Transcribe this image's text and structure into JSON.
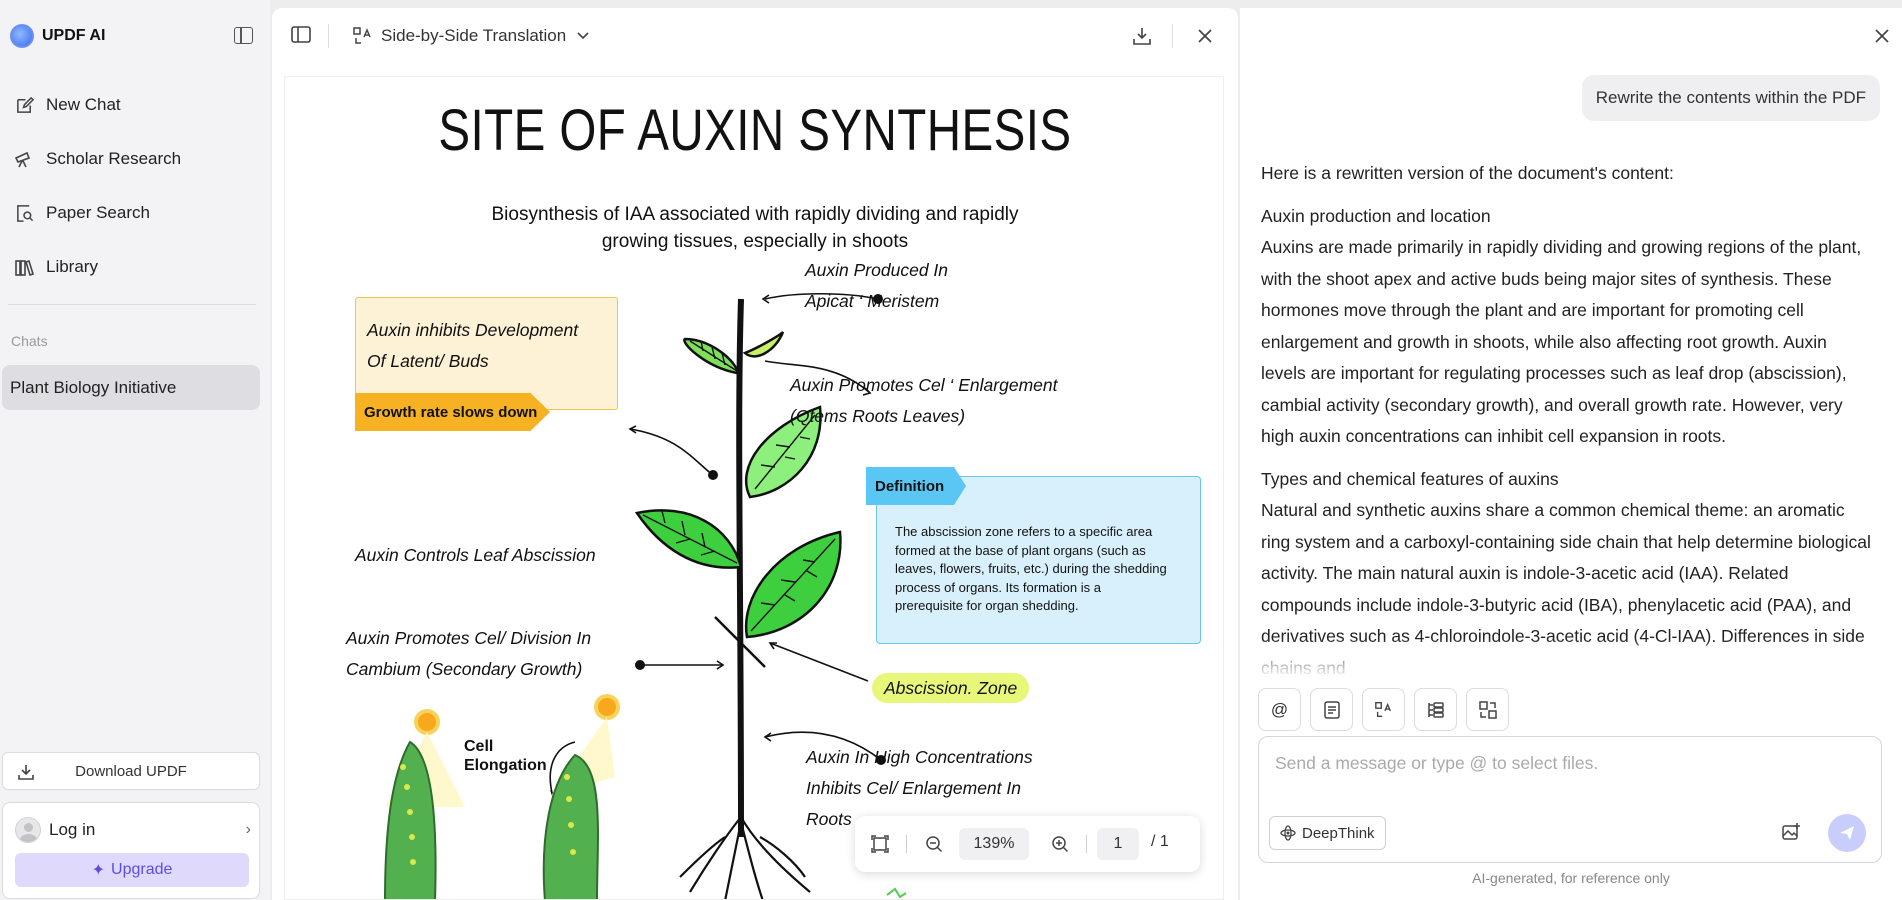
{
  "app": {
    "brand": "UPDF AI"
  },
  "sidebar": {
    "items": [
      {
        "label": "New Chat",
        "icon": "edit-icon"
      },
      {
        "label": "Scholar Research",
        "icon": "telescope-icon"
      },
      {
        "label": "Paper Search",
        "icon": "doc-search-icon"
      },
      {
        "label": "Library",
        "icon": "library-icon"
      }
    ],
    "chats_label": "Chats",
    "chats": [
      {
        "label": "Plant Biology Initiative"
      }
    ],
    "download_label": "Download UPDF",
    "login_label": "Log in",
    "upgrade_label": "Upgrade"
  },
  "viewer": {
    "mode": "Side-by-Side Translation",
    "zoom": "139%",
    "page": "1",
    "page_total": "/ 1"
  },
  "document": {
    "title": "SITE OF AUXIN SYNTHESIS",
    "subtitle": "Biosynthesis of IAA associated with rapidly dividing and rapidly growing tissues, especially in shoots",
    "callout_line1": "Auxin inhibits Development",
    "callout_line2": "Of Latent/ Buds",
    "growth_tag": "Growth rate slows down",
    "label_meristem_1": "Auxin Produced In",
    "label_meristem_2": "Apicat ‘ Meristem",
    "label_enlarge_1": "Auxin Promotes Cel ‘ Enlargement",
    "label_enlarge_2": "(Qtems Roots Leaves)",
    "label_abscission": "Auxin Controls Leaf Abscission",
    "label_division_1": "Auxin Promotes Cel/ Division In",
    "label_division_2": "Cambium (Secondary Growth)",
    "definition_tag": "Definition",
    "definition_text": "The abscission zone refers to a specific area formed at the base of plant organs (such as leaves, flowers, fruits, etc.) during the shedding process of organs. Its formation is a prerequisite for organ shedding.",
    "abscission_zone": "Abscission. Zone",
    "cell_elongation_1": "Cell",
    "cell_elongation_2": "Elongation",
    "label_high_1": "Auxin In High Concentrations",
    "label_high_2": "Inhibits Cel/ Enlargement In",
    "label_high_3": "Roots"
  },
  "chat": {
    "user_message": "Rewrite the contents within the PDF",
    "answer_intro": "Here is a rewritten version of the document's content:",
    "section1_heading": "Auxin production and location",
    "section1_body": "Auxins are made primarily in rapidly dividing and growing regions of the plant, with the shoot apex and active buds being major sites of synthesis. These hormones move through the plant and are important for promoting cell enlargement and growth in shoots, while also affecting root growth. Auxin levels are important for regulating processes such as leaf drop (abscission), cambial activity (secondary growth), and overall growth rate. However, very high auxin concentrations can inhibit cell expansion in roots.",
    "section2_heading": "Types and chemical features of auxins",
    "section2_body": "Natural and synthetic auxins share a common chemical theme: an aromatic ring system and a carboxyl-containing side chain that help determine biological activity. The main natural auxin is indole-3-acetic acid (IAA). Related compounds include indole-3-butyric acid (IBA), phenylacetic acid (PAA), and derivatives such as 4-chloroindole-3-acetic acid (4-Cl-IAA). Differences in side chains and",
    "input_placeholder": "Send a message or type @ to select files.",
    "deepthink_label": "DeepThink",
    "disclaimer": "AI-generated, for reference only"
  },
  "colors": {
    "accent": "#5b4ee6",
    "callout_yellow": "#f7b224",
    "definition_blue": "#5ac6f3",
    "abscission_green": "#e8f77a",
    "leaf_green": "#3ecf3e"
  }
}
